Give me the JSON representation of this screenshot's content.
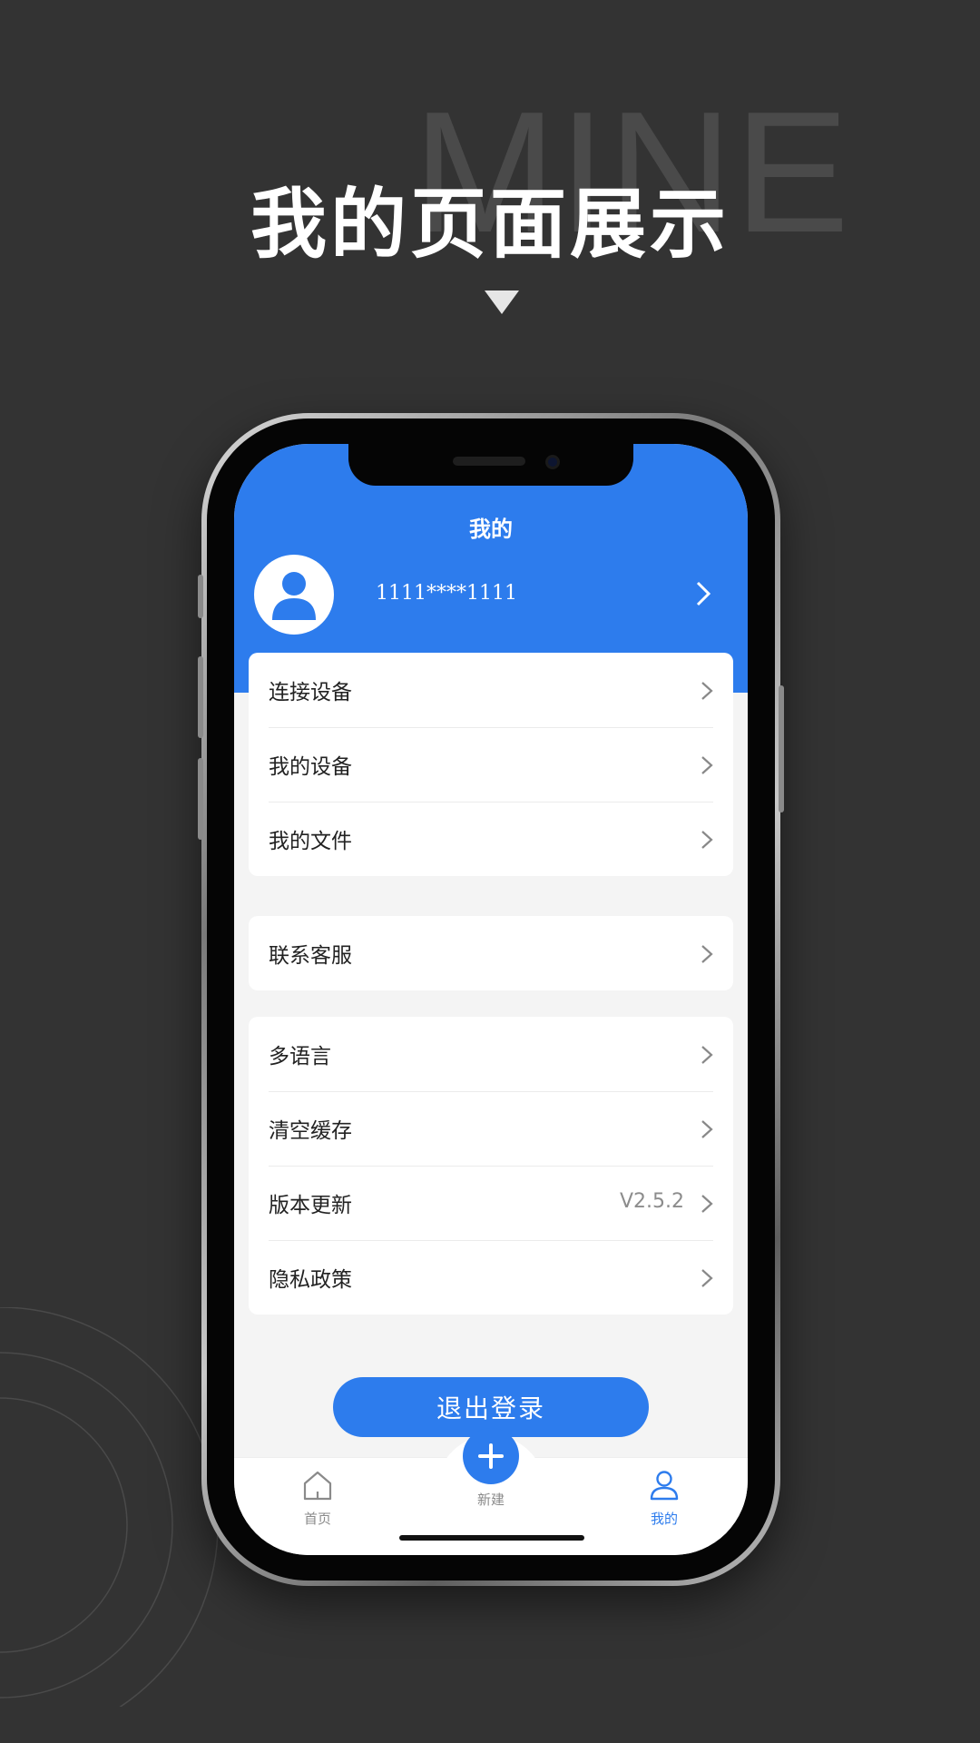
{
  "promo": {
    "background_word": "MINE",
    "title": "我的页面展示"
  },
  "screen": {
    "title": "我的",
    "profile": {
      "phone_number": "1111****1111"
    },
    "menu_groups": [
      {
        "items": [
          {
            "label": "连接设备"
          },
          {
            "label": "我的设备"
          },
          {
            "label": "我的文件"
          }
        ]
      },
      {
        "items": [
          {
            "label": "联系客服"
          }
        ]
      },
      {
        "items": [
          {
            "label": "多语言"
          },
          {
            "label": "清空缓存"
          },
          {
            "label": "版本更新",
            "value": "V2.5.2"
          },
          {
            "label": "隐私政策"
          }
        ]
      }
    ],
    "logout_label": "退出登录",
    "tabbar": {
      "home_label": "首页",
      "new_label": "新建",
      "mine_label": "我的",
      "active_tab": "mine"
    }
  },
  "colors": {
    "accent": "#2d7ced",
    "background": "#333333"
  },
  "icons": [
    "triangle-down-icon",
    "user-avatar-icon",
    "chevron-right-icon",
    "home-icon",
    "plus-icon",
    "person-icon"
  ]
}
